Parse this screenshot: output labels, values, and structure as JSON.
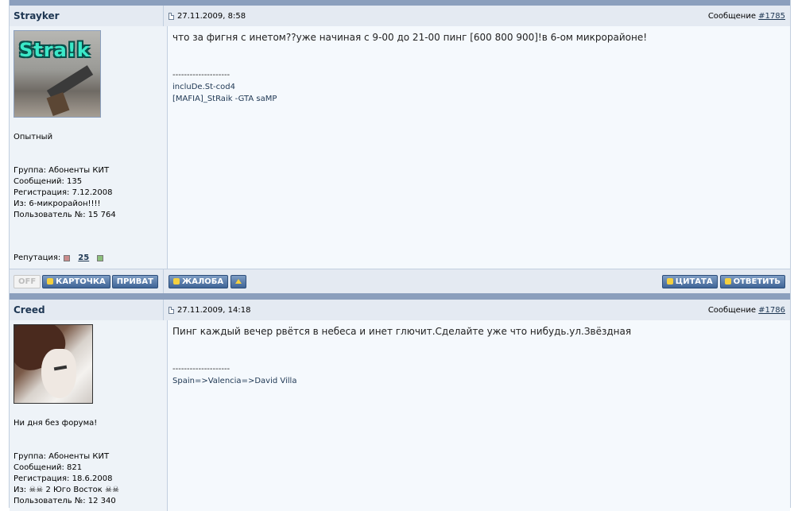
{
  "posts": [
    {
      "author": "Strayker",
      "avatar_text": "Stra!k",
      "date": "27.11.2009, 8:58",
      "msg_label": "Сообщение",
      "msg_num": "#1785",
      "rank": "Опытный",
      "group": "Группа: Абоненты КИТ",
      "messages": "Сообщений: 135",
      "registered": "Регистрация: 7.12.2008",
      "from": "Из: 6-микрорайон!!!!",
      "user_no": "Пользователь №: 15 764",
      "rep_label": "Репутация:",
      "rep_value": "25",
      "text": "что за фигня с инетом??уже начиная с 9-00 до 21-00 пинг [600 800 900]!в 6-ом микрорайоне!",
      "sig_line": "--------------------",
      "sig_1": "incluDe.St-cod4",
      "sig_2": "[MAFIA]_StRaik -GTA saMP"
    },
    {
      "author": "Creed",
      "date": "27.11.2009, 14:18",
      "msg_label": "Сообщение",
      "msg_num": "#1786",
      "rank": "Ни дня без форума!",
      "group": "Группа: Абоненты КИТ",
      "messages": "Сообщений: 821",
      "registered": "Регистрация: 18.6.2008",
      "from": "Из: ☠☠ 2 Юго Восток ☠☠",
      "user_no": "Пользователь №: 12 340",
      "text": "Пинг каждый вечер рвётся в небеса и инет глючит.Сделайте уже что нибудь.ул.Звёздная",
      "sig_line": "--------------------",
      "sig_1": "Spain=>Valencia=>David Villa"
    }
  ],
  "buttons": {
    "off": "OFF",
    "card": "КАРТОЧКА",
    "private": "ПРИВАТ",
    "report": "ЖАЛОБА",
    "quote": "ЦИТАТА",
    "reply": "ОТВЕТИТЬ"
  }
}
